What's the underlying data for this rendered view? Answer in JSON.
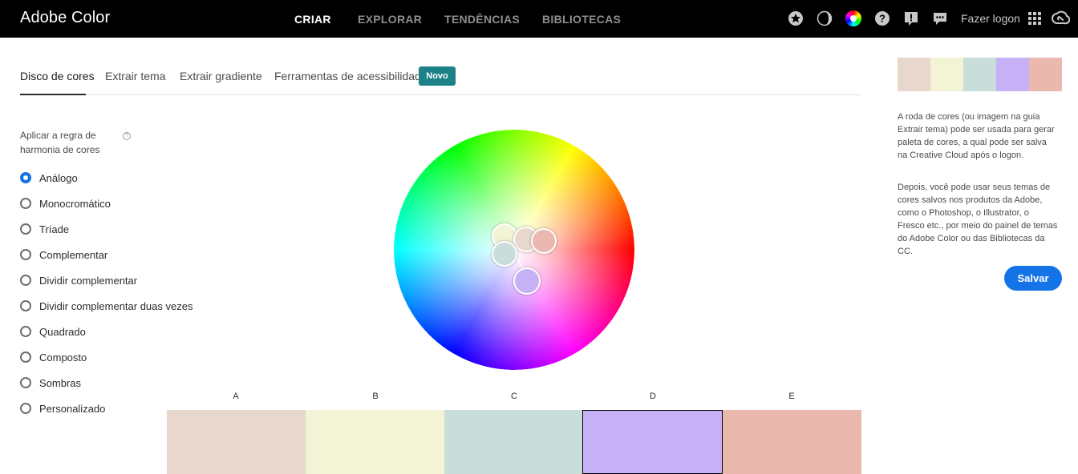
{
  "app": {
    "title": "Adobe Color"
  },
  "topnav": {
    "items": [
      "CRIAR",
      "EXPLORAR",
      "TENDÊNCIAS",
      "BIBLIOTECAS"
    ],
    "login_label": "Fazer logon",
    "icons": [
      "star-icon",
      "contrast-icon",
      "color-wheel-icon",
      "help-icon",
      "feedback-icon",
      "chat-icon",
      "apps-grid-icon",
      "creative-cloud-icon"
    ]
  },
  "tabs": {
    "items": [
      "Disco de cores",
      "Extrair tema",
      "Extrair gradiente",
      "Ferramentas de acessibilidade"
    ],
    "active": "Disco de cores",
    "badge": "Novo"
  },
  "harmony": {
    "label": "Aplicar a regra de harmonia de cores",
    "selected": "Análogo",
    "options": [
      "Análogo",
      "Monocromático",
      "Tríade",
      "Complementar",
      "Dividir complementar",
      "Dividir complementar duas vezes",
      "Quadrado",
      "Composto",
      "Sombras",
      "Personalizado"
    ]
  },
  "swatches": [
    {
      "label": "A",
      "color": "#E8D7CC"
    },
    {
      "label": "B",
      "color": "#F3F3D5"
    },
    {
      "label": "C",
      "color": "#C9DDDA"
    },
    {
      "label": "D",
      "color": "#C7B1F6"
    },
    {
      "label": "E",
      "color": "#EAB8AF"
    }
  ],
  "selected_swatch": "D",
  "sidebar": {
    "info1": "A roda de cores (ou imagem na guia Extrair tema) pode ser usada para gerar paleta de cores, a qual pode ser salva na Creative Cloud após o logon.",
    "info2": "Depois, você pode usar seus temas de cores salvos nos produtos da Adobe, como o Photoshop, o Illustrator, o Fresco etc., por meio do painel de temas do Adobe Color ou das Bibliotecas da CC.",
    "save_label": "Salvar"
  },
  "colors": {
    "accent": "#1473E6",
    "badge": "#1C8288"
  }
}
